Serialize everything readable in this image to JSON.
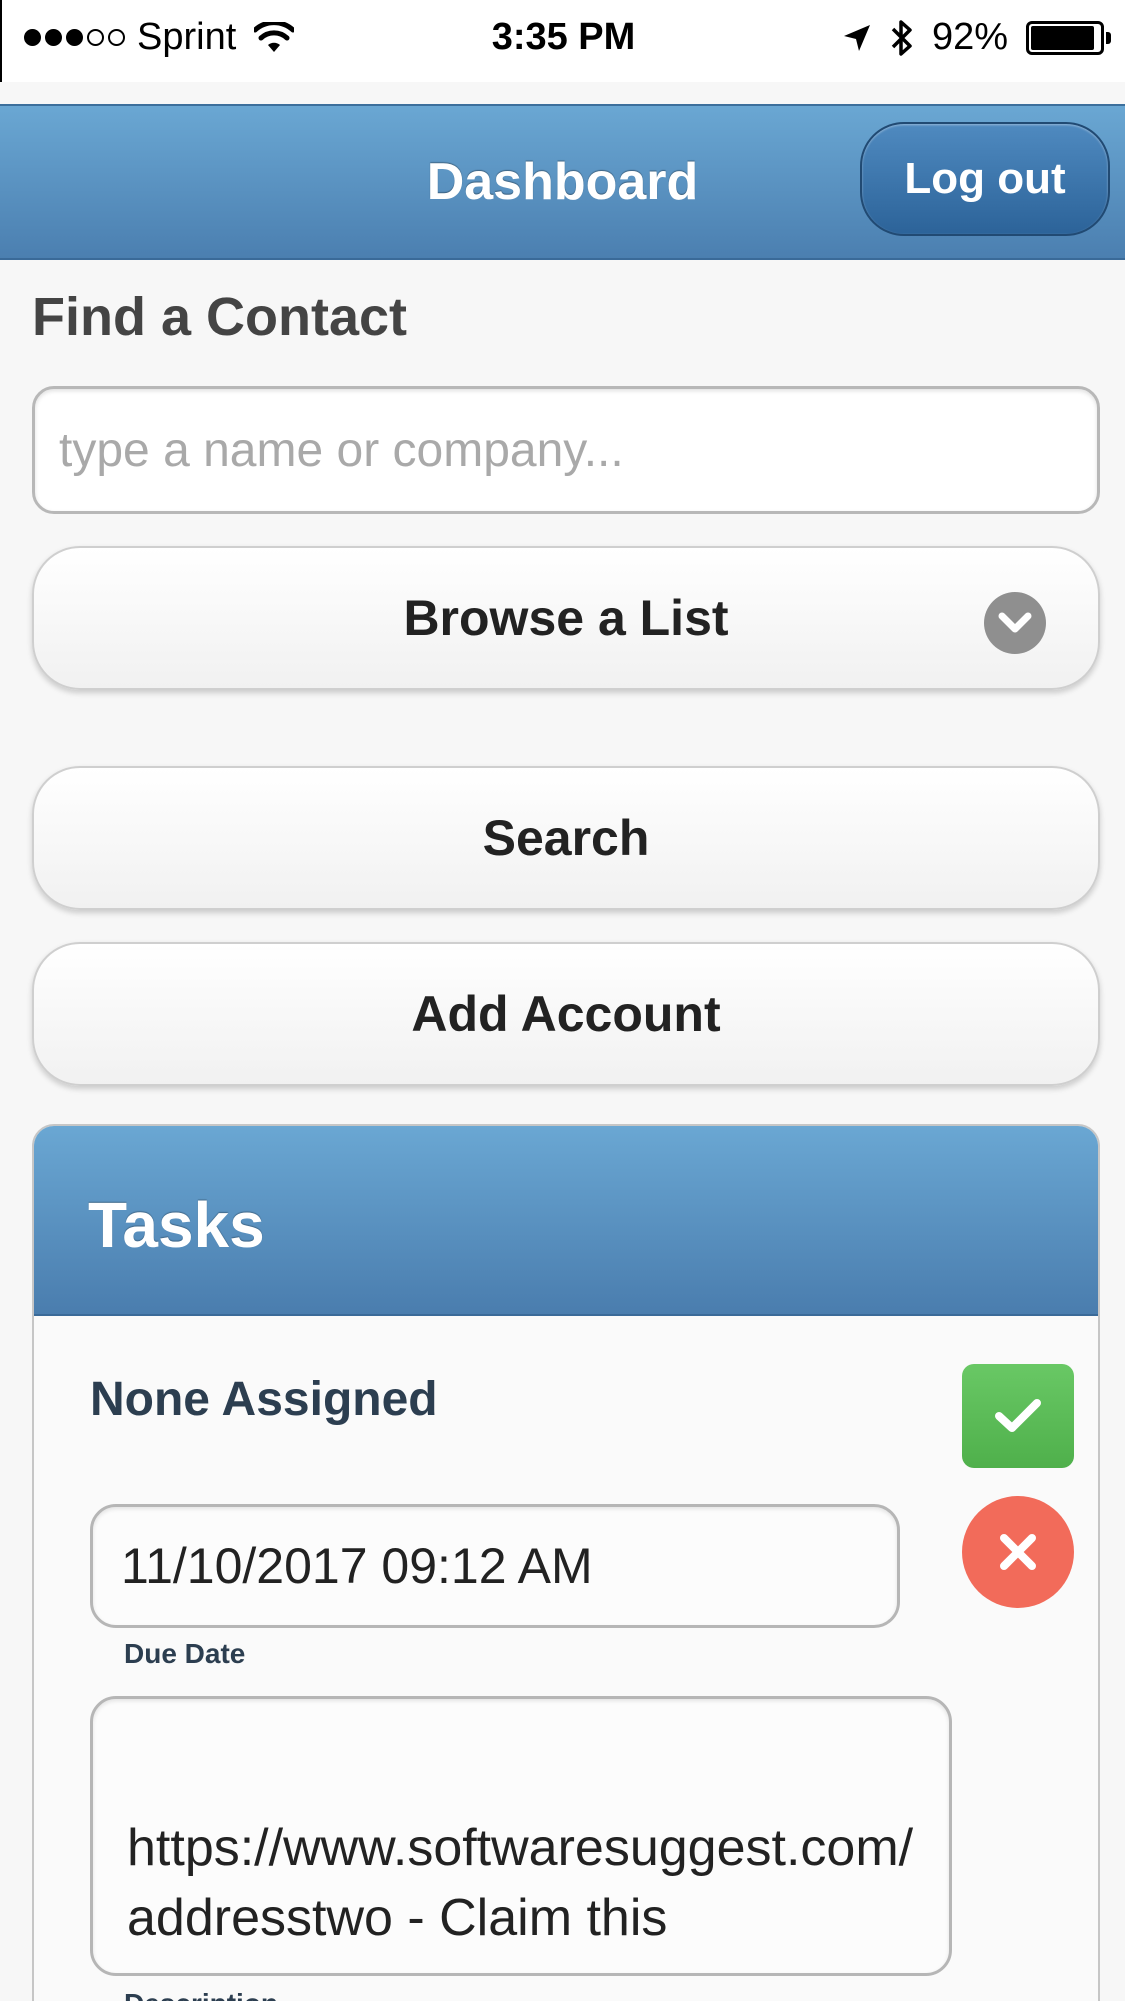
{
  "status_bar": {
    "carrier": "Sprint",
    "signal_bars_filled": 3,
    "signal_bars_total": 5,
    "time": "3:35 PM",
    "battery_percent": "92%",
    "battery_level": 0.92,
    "icons": [
      "wifi-icon",
      "location-arrow-icon",
      "bluetooth-icon",
      "battery-icon"
    ]
  },
  "header": {
    "title": "Dashboard",
    "logout_label": "Log out"
  },
  "find_contact": {
    "label": "Find a Contact",
    "search_value": "",
    "search_placeholder": "type a name or company...",
    "browse_label": "Browse a List",
    "search_label": "Search",
    "add_account_label": "Add Account"
  },
  "tasks": {
    "title": "Tasks",
    "assignee": "None Assigned",
    "due_date_value": "11/10/2017 09:12 AM",
    "due_date_label": "Due Date",
    "description_value": "https://www.softwaresuggest.com/addresstwo - Claim this",
    "description_label": "Description"
  },
  "colors": {
    "header_blue": "#5b93c6",
    "complete_green": "#5cbf58",
    "delete_red": "#f26b5a"
  }
}
